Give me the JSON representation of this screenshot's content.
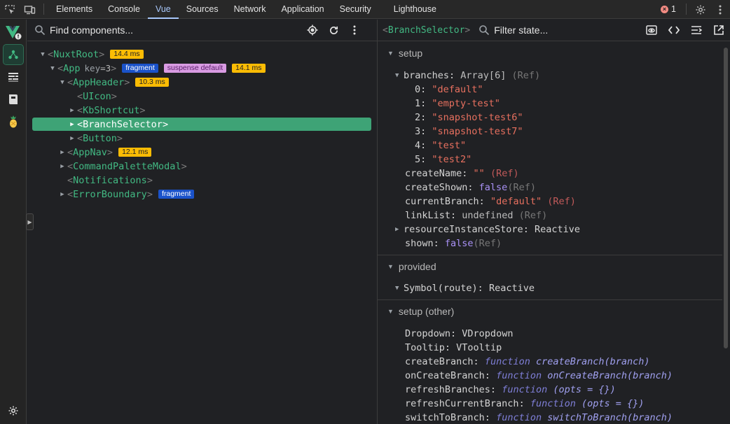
{
  "topbar": {
    "tabs": [
      "Elements",
      "Console",
      "Vue",
      "Sources",
      "Network",
      "Application",
      "Security",
      "Lighthouse"
    ],
    "active_tab": "Vue",
    "error_count": "1"
  },
  "components": {
    "search_placeholder": "Find components...",
    "tree": [
      {
        "name": "NuxtRoot",
        "badges": [
          {
            "kind": "time",
            "text": "14.4 ms"
          }
        ]
      },
      {
        "name": "App",
        "attr_key": "key",
        "attr_val": "=3",
        "badges": [
          {
            "kind": "frag",
            "text": "fragment"
          },
          {
            "kind": "susp",
            "text": "suspense default"
          },
          {
            "kind": "time",
            "text": "14.1 ms"
          }
        ]
      },
      {
        "name": "AppHeader",
        "badges": [
          {
            "kind": "time",
            "text": "10.3 ms"
          }
        ]
      },
      {
        "name": "UIcon",
        "badges": []
      },
      {
        "name": "KbShortcut",
        "badges": []
      },
      {
        "name": "BranchSelector",
        "badges": []
      },
      {
        "name": "Button",
        "badges": []
      },
      {
        "name": "AppNav",
        "badges": [
          {
            "kind": "time",
            "text": "12.1 ms"
          }
        ]
      },
      {
        "name": "CommandPaletteModal",
        "badges": []
      },
      {
        "name": "Notifications",
        "badges": []
      },
      {
        "name": "ErrorBoundary",
        "badges": [
          {
            "kind": "frag",
            "text": "fragment"
          }
        ]
      }
    ]
  },
  "state": {
    "component_name": "BranchSelector",
    "filter_placeholder": "Filter state...",
    "setup": {
      "title": "setup",
      "branches_key": "branches",
      "branches_type": "Array[6]",
      "branches_ref": "(Ref)",
      "branches": [
        {
          "i": "0",
          "v": "\"default\""
        },
        {
          "i": "1",
          "v": "\"empty-test\""
        },
        {
          "i": "2",
          "v": "\"snapshot-test6\""
        },
        {
          "i": "3",
          "v": "\"snapshot-test7\""
        },
        {
          "i": "4",
          "v": "\"test\""
        },
        {
          "i": "5",
          "v": "\"test2\""
        }
      ],
      "createName_key": "createName",
      "createName_val": "\"\"",
      "createName_ref": "(Ref)",
      "createShown_key": "createShown",
      "createShown_val": "false",
      "createShown_ref": "(Ref)",
      "currentBranch_key": "currentBranch",
      "currentBranch_val": "\"default\"",
      "currentBranch_ref": "(Ref)",
      "linkList_key": "linkList",
      "linkList_val": "undefined",
      "linkList_ref": "(Ref)",
      "resource_key": "resourceInstanceStore",
      "resource_val": "Reactive",
      "shown_key": "shown",
      "shown_val": "false",
      "shown_ref": "(Ref)"
    },
    "provided": {
      "title": "provided",
      "symbol_key": "Symbol(route)",
      "symbol_val": "Reactive"
    },
    "setup_other": {
      "title": "setup (other)",
      "dropdown_key": "Dropdown",
      "dropdown_val": "VDropdown",
      "tooltip_key": "Tooltip",
      "tooltip_val": "VTooltip",
      "functions": [
        {
          "key": "createBranch",
          "kw": "function",
          "sig": "createBranch(branch)"
        },
        {
          "key": "onCreateBranch",
          "kw": "function",
          "sig": "onCreateBranch(branch)"
        },
        {
          "key": "refreshBranches",
          "kw": "function",
          "sig": "(opts = {})"
        },
        {
          "key": "refreshCurrentBranch",
          "kw": "function",
          "sig": "(opts = {})"
        },
        {
          "key": "switchToBranch",
          "kw": "function",
          "sig": "switchToBranch(branch)"
        }
      ]
    }
  },
  "colors": {
    "vue_green": "#42b983",
    "selected_row": "#3ea376",
    "string": "#e8705f",
    "boolean": "#a991f5",
    "time_badge": "#fbbc04",
    "fragment_badge": "#1a52c9"
  }
}
